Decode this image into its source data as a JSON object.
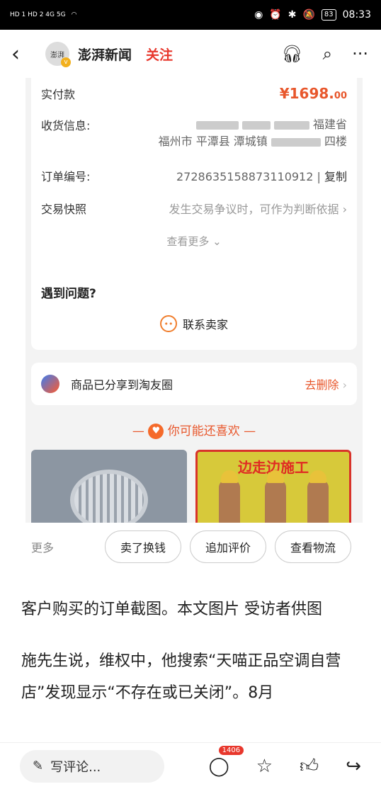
{
  "status": {
    "left": "HD 1 HD 2 4G 5G",
    "battery": "83",
    "time": "08:33"
  },
  "header": {
    "back": "‹",
    "avatar": "澎湃",
    "name": "澎湃新闻",
    "follow": "关注"
  },
  "order": {
    "paid_label": "实付款",
    "paid_value_main": "¥1698.",
    "paid_value_cents": "00",
    "address_label": "收货信息:",
    "address_line1": "福建省",
    "address_line2": "福州市 平潭县 潭城镇",
    "address_line2_end": "四楼",
    "order_no_label": "订单编号:",
    "order_no": "2728635158873110912",
    "copy": "复制",
    "snapshot_label": "交易快照",
    "snapshot_value": "发生交易争议时，可作为判断依据",
    "see_more": "查看更多"
  },
  "problem": {
    "title": "遇到问题?",
    "contact": "联系卖家"
  },
  "share": {
    "text": "商品已分享到淘友圈",
    "delete": "去删除"
  },
  "guess": {
    "title": "你可能还喜欢"
  },
  "product2_caption": "边走边施工",
  "actions": {
    "more": "更多",
    "sell": "卖了换钱",
    "review": "追加评价",
    "logistics": "查看物流"
  },
  "article": {
    "p1": "客户购买的订单截图。本文图片 受访者供图",
    "p2": "施先生说，维权中，他搜索“天喵正品空调自营店”发现显示“不存在或已关闭”。8月"
  },
  "bottom": {
    "comment_placeholder": "写评论...",
    "comment_count": "1406"
  }
}
